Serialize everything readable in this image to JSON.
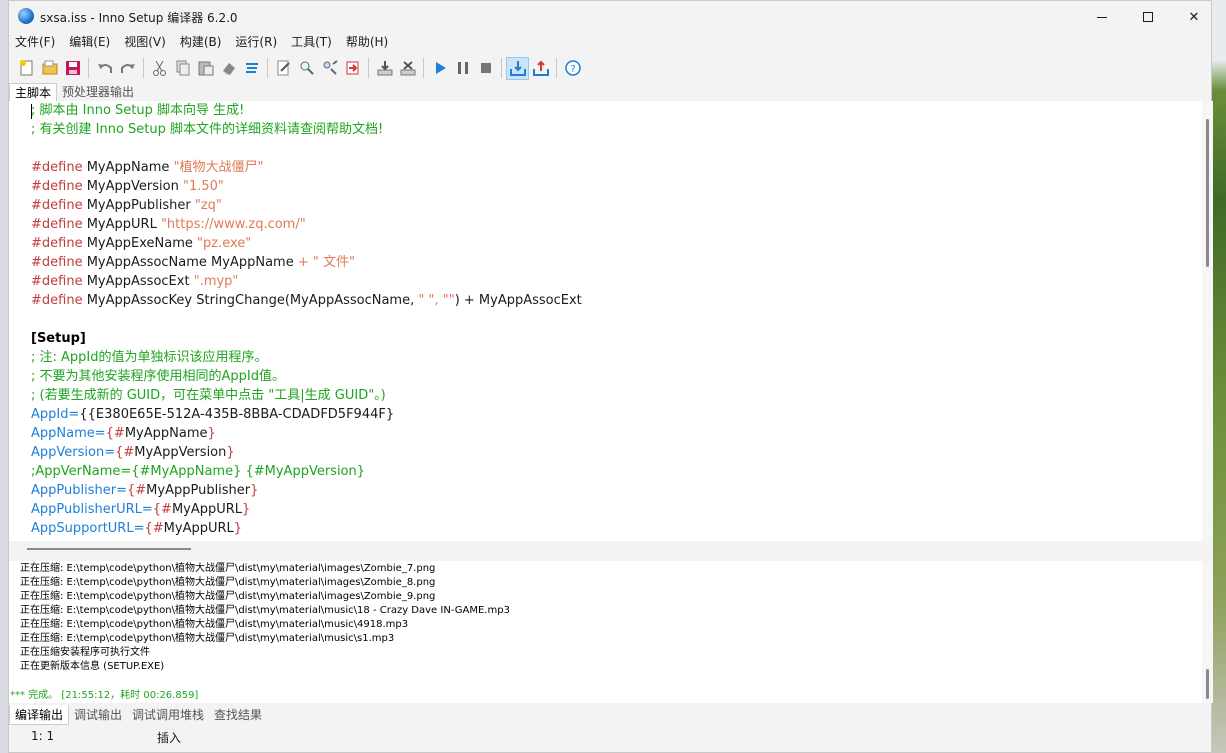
{
  "window": {
    "title": "sxsa.iss - Inno Setup 编译器 6.2.0"
  },
  "menu": [
    "文件(F)",
    "编辑(E)",
    "视图(V)",
    "构建(B)",
    "运行(R)",
    "工具(T)",
    "帮助(H)"
  ],
  "toolbar": {
    "icons": [
      "new-file-icon",
      "open-file-icon",
      "save-icon",
      "undo-icon",
      "redo-icon",
      "cut-icon",
      "copy-icon",
      "paste-icon",
      "clear-icon",
      "format-icon",
      "compile-options-icon",
      "find-icon",
      "find-replace-icon",
      "goto-icon",
      "export-icon",
      "import-icon",
      "run-icon",
      "pause-icon",
      "stop-icon",
      "target-compile-icon",
      "publish-icon",
      "help-icon"
    ]
  },
  "editor_tabs": [
    "主脚本",
    "预处理器输出"
  ],
  "editor": {
    "lines": [
      [
        {
          "t": "; 脚本由 Inno Setup 脚本向导 生成!",
          "c": "comment"
        }
      ],
      [
        {
          "t": "; 有关创建 Inno Setup 脚本文件的详细资料请查阅帮助文档!",
          "c": "comment"
        }
      ],
      [],
      [
        {
          "t": "#define",
          "c": "define"
        },
        {
          "t": " MyAppName ",
          "c": "text"
        },
        {
          "t": "\"植物大战僵尸\"",
          "c": "string"
        }
      ],
      [
        {
          "t": "#define",
          "c": "define"
        },
        {
          "t": " MyAppVersion ",
          "c": "text"
        },
        {
          "t": "\"1.50\"",
          "c": "string"
        }
      ],
      [
        {
          "t": "#define",
          "c": "define"
        },
        {
          "t": " MyAppPublisher ",
          "c": "text"
        },
        {
          "t": "\"zq\"",
          "c": "string"
        }
      ],
      [
        {
          "t": "#define",
          "c": "define"
        },
        {
          "t": " MyAppURL ",
          "c": "text"
        },
        {
          "t": "\"https://www.zq.com/\"",
          "c": "string"
        }
      ],
      [
        {
          "t": "#define",
          "c": "define"
        },
        {
          "t": " MyAppExeName ",
          "c": "text"
        },
        {
          "t": "\"pz.exe\"",
          "c": "string"
        }
      ],
      [
        {
          "t": "#define",
          "c": "define"
        },
        {
          "t": " MyAppAssocName MyAppName ",
          "c": "text"
        },
        {
          "t": "+ \" 文件\"",
          "c": "string"
        }
      ],
      [
        {
          "t": "#define",
          "c": "define"
        },
        {
          "t": " MyAppAssocExt ",
          "c": "text"
        },
        {
          "t": "\".myp\"",
          "c": "string"
        }
      ],
      [
        {
          "t": "#define",
          "c": "define"
        },
        {
          "t": " MyAppAssocKey StringChange(MyAppAssocName, ",
          "c": "text"
        },
        {
          "t": "\" \", \"\"",
          "c": "string"
        },
        {
          "t": ") + MyAppAssocExt",
          "c": "text"
        }
      ],
      [],
      [
        {
          "t": "[Setup]",
          "c": "section"
        }
      ],
      [
        {
          "t": "; 注: AppId的值为单独标识该应用程序。",
          "c": "comment"
        }
      ],
      [
        {
          "t": "; 不要为其他安装程序使用相同的AppId值。",
          "c": "comment"
        }
      ],
      [
        {
          "t": "; (若要生成新的 GUID，可在菜单中点击 \"工具|生成 GUID\"。)",
          "c": "comment"
        }
      ],
      [
        {
          "t": "AppId=",
          "c": "key"
        },
        {
          "t": "{{E380E65E-512A-435B-8BBA-CDADFD5F944F}",
          "c": "text"
        }
      ],
      [
        {
          "t": "AppName=",
          "c": "key"
        },
        {
          "t": "{#",
          "c": "brace"
        },
        {
          "t": "MyAppName",
          "c": "text"
        },
        {
          "t": "}",
          "c": "brace"
        }
      ],
      [
        {
          "t": "AppVersion=",
          "c": "key"
        },
        {
          "t": "{#",
          "c": "brace"
        },
        {
          "t": "MyAppVersion",
          "c": "text"
        },
        {
          "t": "}",
          "c": "brace"
        }
      ],
      [
        {
          "t": ";AppVerName={#MyAppName} {#MyAppVersion}",
          "c": "comment"
        }
      ],
      [
        {
          "t": "AppPublisher=",
          "c": "key"
        },
        {
          "t": "{#",
          "c": "brace"
        },
        {
          "t": "MyAppPublisher",
          "c": "text"
        },
        {
          "t": "}",
          "c": "brace"
        }
      ],
      [
        {
          "t": "AppPublisherURL=",
          "c": "key"
        },
        {
          "t": "{#",
          "c": "brace"
        },
        {
          "t": "MyAppURL",
          "c": "text"
        },
        {
          "t": "}",
          "c": "brace"
        }
      ],
      [
        {
          "t": "AppSupportURL=",
          "c": "key"
        },
        {
          "t": "{#",
          "c": "brace"
        },
        {
          "t": "MyAppURL",
          "c": "text"
        },
        {
          "t": "}",
          "c": "brace"
        }
      ]
    ]
  },
  "output": {
    "lines": [
      "正在压缩: E:\\temp\\code\\python\\植物大战僵尸\\dist\\my\\material\\images\\Zombie_7.png",
      "正在压缩: E:\\temp\\code\\python\\植物大战僵尸\\dist\\my\\material\\images\\Zombie_8.png",
      "正在压缩: E:\\temp\\code\\python\\植物大战僵尸\\dist\\my\\material\\images\\Zombie_9.png",
      "正在压缩: E:\\temp\\code\\python\\植物大战僵尸\\dist\\my\\material\\music\\18 - Crazy Dave IN-GAME.mp3",
      "正在压缩: E:\\temp\\code\\python\\植物大战僵尸\\dist\\my\\material\\music\\4918.mp3",
      "正在压缩: E:\\temp\\code\\python\\植物大战僵尸\\dist\\my\\material\\music\\s1.mp3",
      "正在压缩安装程序可执行文件",
      "正在更新版本信息 (SETUP.EXE)"
    ],
    "done": "*** 完成。 [21:55:12，耗时 00:26.859]"
  },
  "output_tabs": [
    "编译输出",
    "调试输出",
    "调试调用堆栈",
    "查找结果"
  ],
  "status": {
    "position": "1:   1",
    "mode": "插入"
  },
  "colors": {
    "comment": "#1fa51f",
    "define": "#c23c3c",
    "string": "#e07a57",
    "key": "#1e7fd8"
  }
}
